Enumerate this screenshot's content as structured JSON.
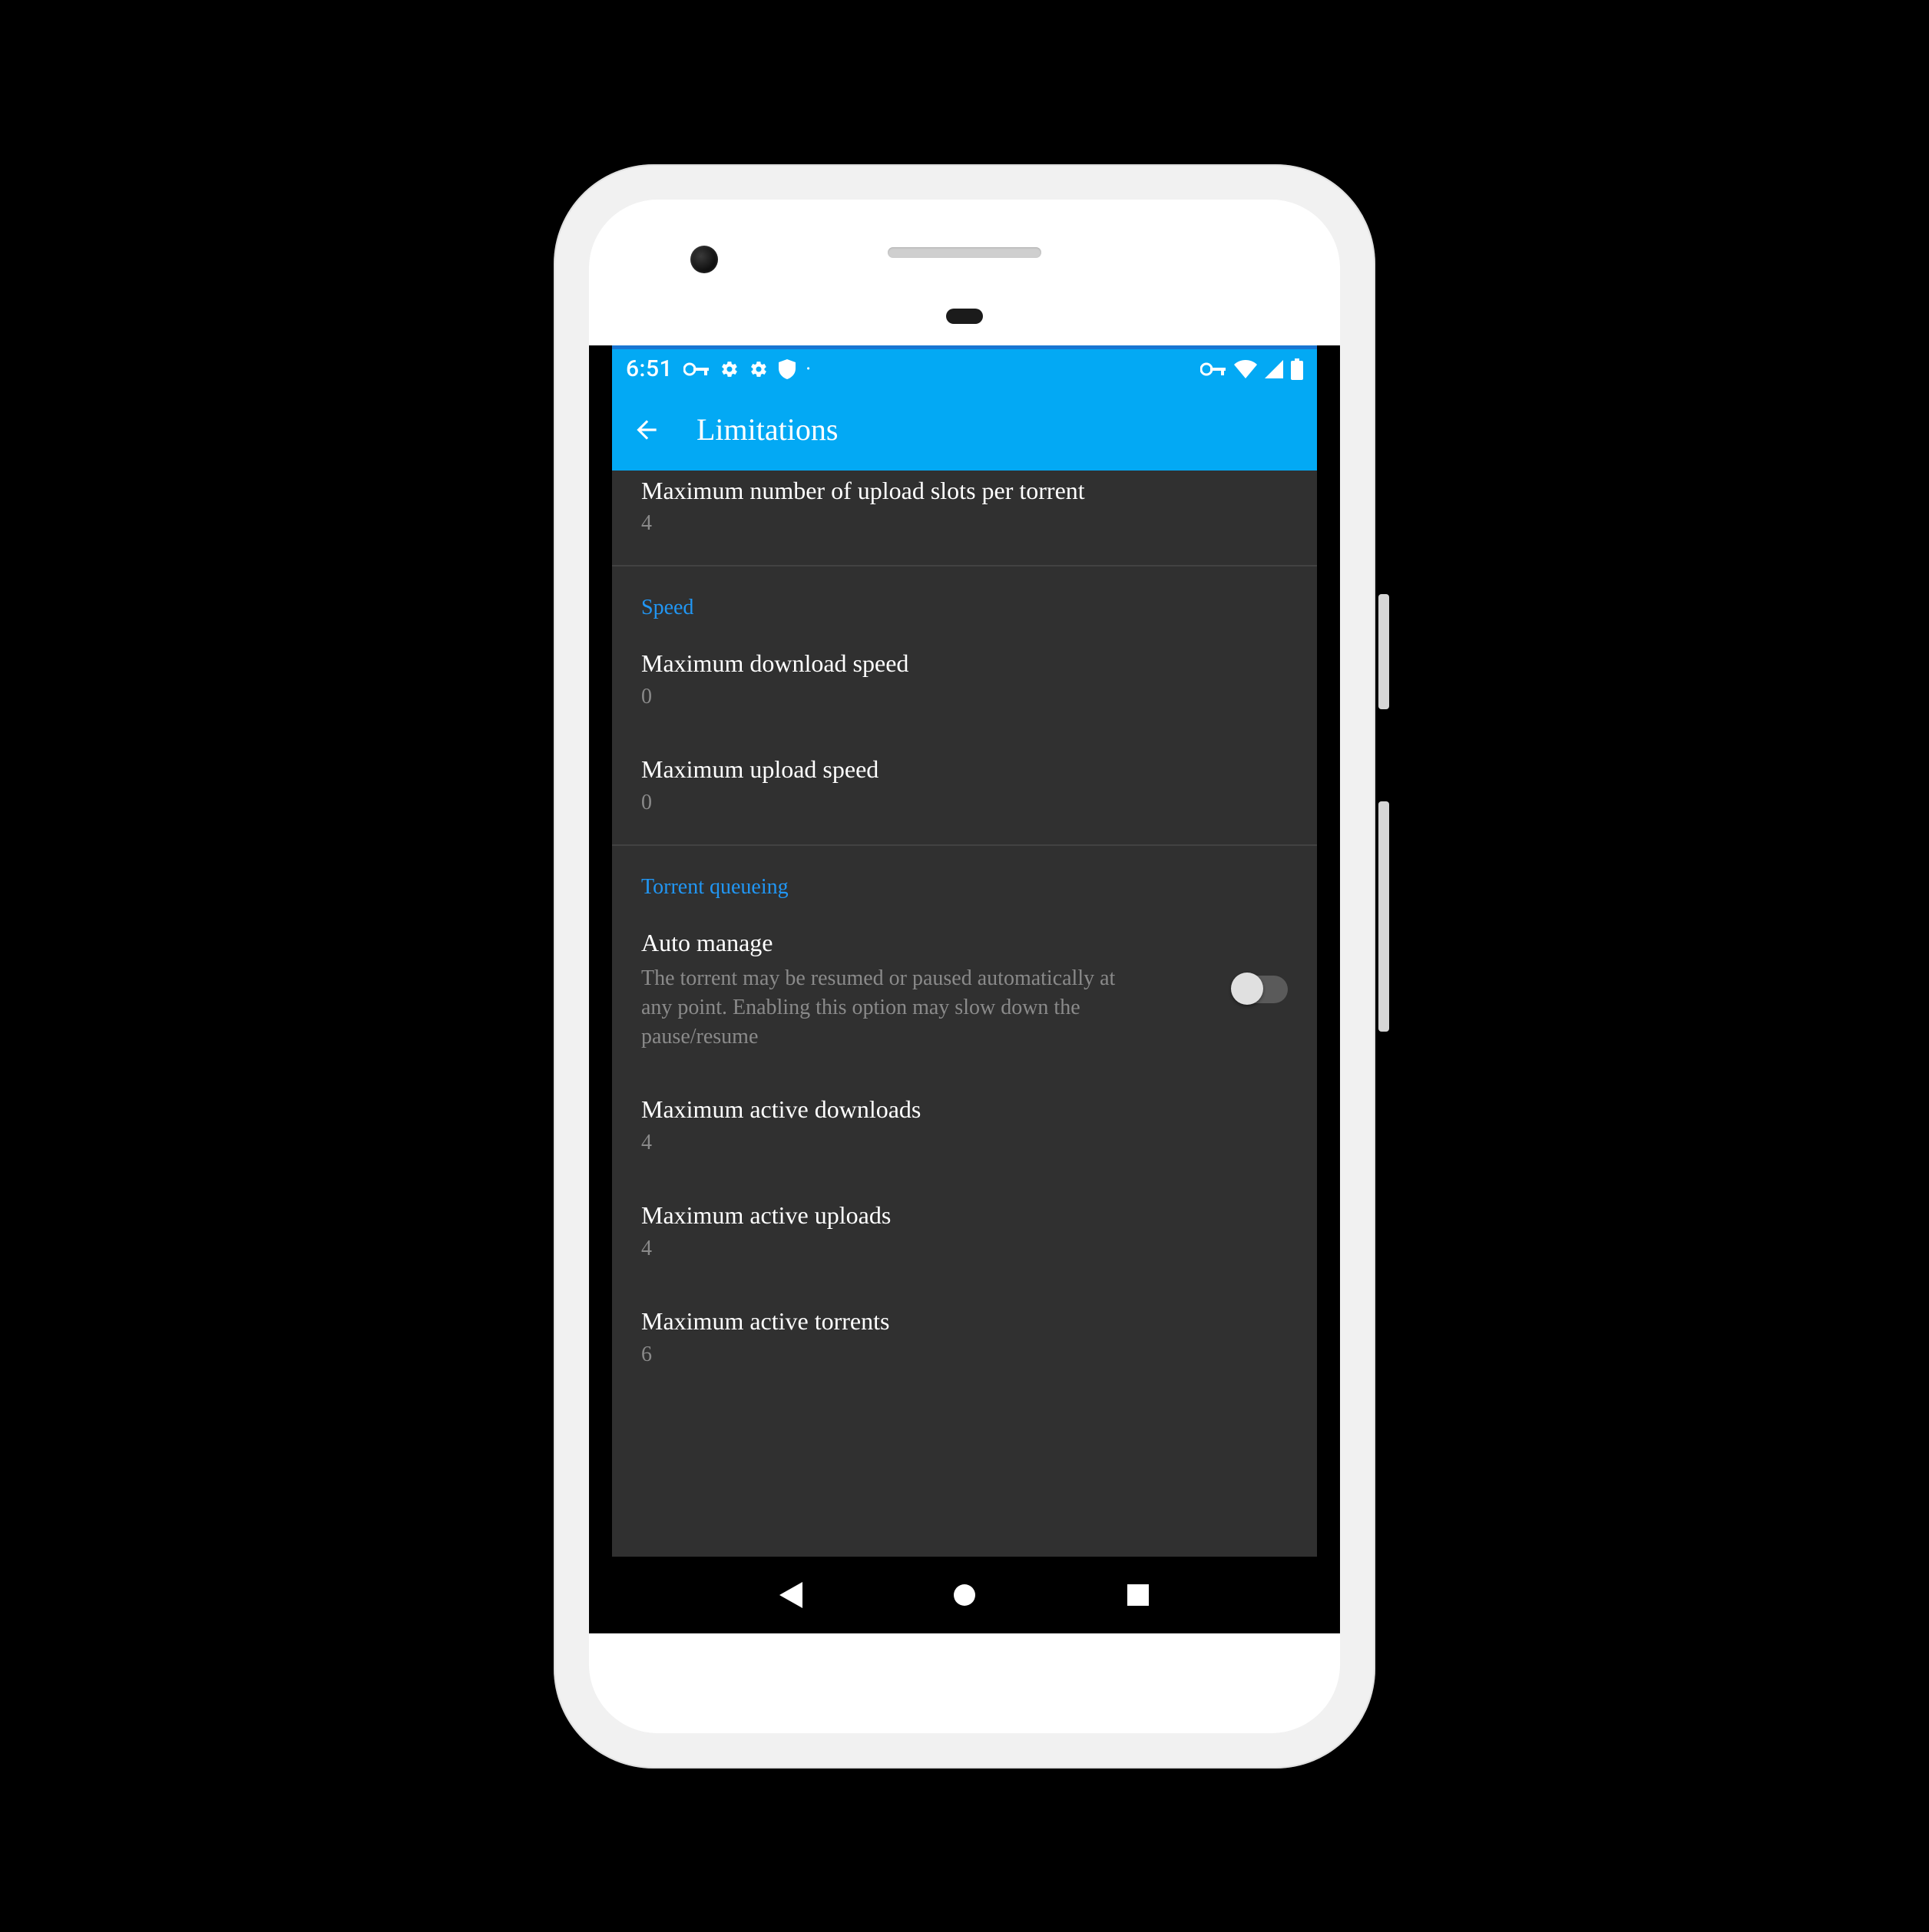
{
  "status": {
    "time": "6:51"
  },
  "appbar": {
    "title": "Limitations"
  },
  "settings": {
    "uploadSlots": {
      "title": "Maximum number of upload slots per torrent",
      "value": "4"
    },
    "sectionSpeed": "Speed",
    "maxDownload": {
      "title": "Maximum download speed",
      "value": "0"
    },
    "maxUpload": {
      "title": "Maximum upload speed",
      "value": "0"
    },
    "sectionQueue": "Torrent queueing",
    "autoManage": {
      "title": "Auto manage",
      "subtitle": "The torrent may be resumed or paused automatically at any point. Enabling this option may slow down the pause/resume",
      "enabled": false
    },
    "activeDownloads": {
      "title": "Maximum active downloads",
      "value": "4"
    },
    "activeUploads": {
      "title": "Maximum active uploads",
      "value": "4"
    },
    "activeTorrents": {
      "title": "Maximum active torrents",
      "value": "6"
    }
  }
}
